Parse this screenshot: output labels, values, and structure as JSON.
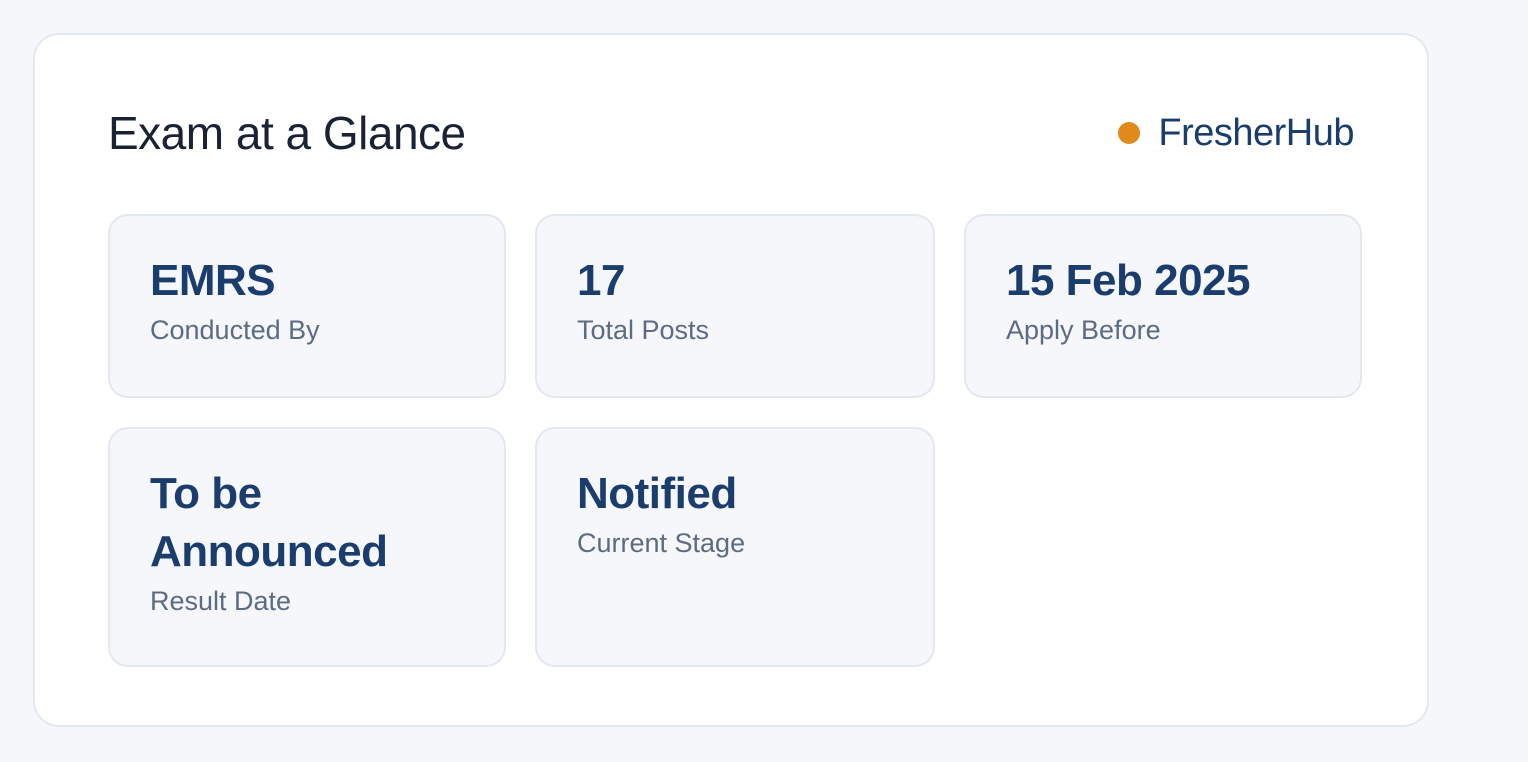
{
  "card": {
    "title": "Exam at a Glance",
    "brand": {
      "name": "FresherHub",
      "dot_color": "#e08a1e"
    }
  },
  "stats": [
    {
      "value": "EMRS",
      "label": "Conducted By"
    },
    {
      "value": "17",
      "label": "Total Posts"
    },
    {
      "value": "15 Feb 2025",
      "label": "Apply Before"
    },
    {
      "value": "To be Announced",
      "label": "Result Date"
    },
    {
      "value": "Notified",
      "label": "Current Stage"
    }
  ],
  "colors": {
    "accent": "#1a3d6e",
    "muted_text": "#5d6b82",
    "brand_dot": "#e08a1e"
  }
}
